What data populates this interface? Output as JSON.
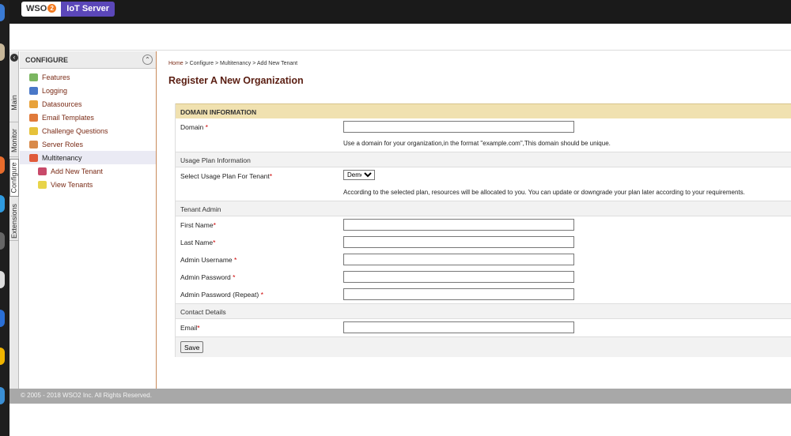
{
  "logo": {
    "brand": "WSO",
    "brand_suffix": "2",
    "product": "IoT Server"
  },
  "vtabs": [
    "Main",
    "Monitor",
    "Configure",
    "Extensions"
  ],
  "menu": {
    "header": "CONFIGURE",
    "items": [
      {
        "label": "Features",
        "icon": "features-icon"
      },
      {
        "label": "Logging",
        "icon": "logging-icon"
      },
      {
        "label": "Datasources",
        "icon": "datasources-icon"
      },
      {
        "label": "Email Templates",
        "icon": "email-icon"
      },
      {
        "label": "Challenge Questions",
        "icon": "key-icon"
      },
      {
        "label": "Server Roles",
        "icon": "server-roles-icon"
      },
      {
        "label": "Multitenancy",
        "icon": "multitenancy-icon"
      },
      {
        "label": "Add New Tenant",
        "icon": "add-tenant-icon"
      },
      {
        "label": "View Tenants",
        "icon": "view-tenants-icon"
      }
    ]
  },
  "breadcrumb": {
    "home": "Home",
    "rest": " > Configure > Multitenancy > Add New Tenant"
  },
  "page_title": "Register A New Organization",
  "form": {
    "domain_section": "DOMAIN INFORMATION",
    "domain_label": "Domain",
    "domain_hint": "Use a domain for your organization,in the format \"example.com\",This domain should be unique.",
    "usage_section": "Usage Plan Information",
    "usage_label": "Select Usage Plan For Tenant",
    "usage_selected": "Demo",
    "usage_hint": "According to the selected plan, resources will be allocated to you. You can update or downgrade your plan later according to your requirements.",
    "admin_section": "Tenant Admin",
    "first_name_label": "First Name",
    "last_name_label": "Last Name",
    "admin_username_label": "Admin Username",
    "admin_password_label": "Admin Password",
    "admin_password_repeat_label": "Admin Password (Repeat)",
    "contact_section": "Contact Details",
    "email_label": "Email",
    "required_mark": "*",
    "save_label": "Save"
  },
  "footer": "© 2005 - 2018 WSO2 Inc. All Rights Reserved.",
  "colors": {
    "accent": "#7a2b16",
    "section_header": "#f0e1b0",
    "product_badge": "#5b47b9"
  }
}
